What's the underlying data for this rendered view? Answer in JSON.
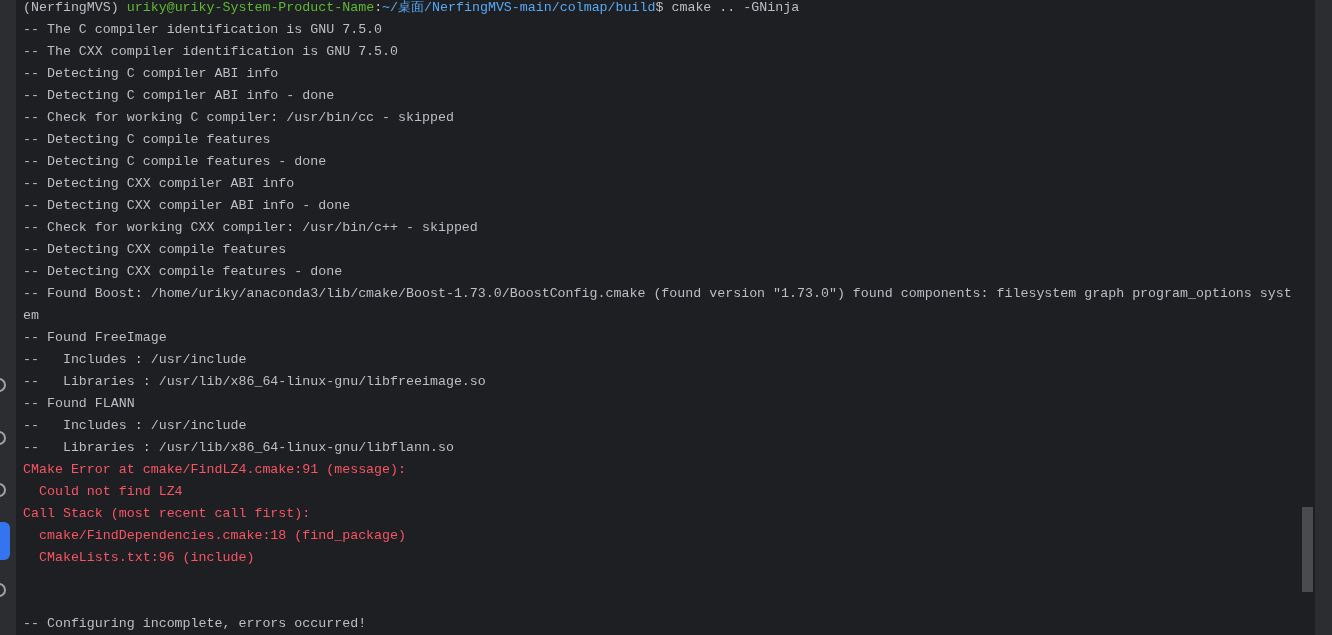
{
  "toolbar": [
    {
      "selected": false
    },
    {
      "selected": false
    },
    {
      "selected": false
    },
    {
      "selected": true
    },
    {
      "selected": false
    }
  ],
  "prompt": {
    "env": "(NerfingMVS)",
    "user_host": "uriky@uriky-System-Product-Name",
    "separator": ":",
    "path": "~/桌面/NerfingMVS-main/colmap/build",
    "command": "$ cmake .. -GNinja"
  },
  "lines": [
    {
      "kind": "info",
      "text": "-- The C compiler identification is GNU 7.5.0"
    },
    {
      "kind": "info",
      "text": "-- The CXX compiler identification is GNU 7.5.0"
    },
    {
      "kind": "info",
      "text": "-- Detecting C compiler ABI info"
    },
    {
      "kind": "info",
      "text": "-- Detecting C compiler ABI info - done"
    },
    {
      "kind": "info",
      "text": "-- Check for working C compiler: /usr/bin/cc - skipped"
    },
    {
      "kind": "info",
      "text": "-- Detecting C compile features"
    },
    {
      "kind": "info",
      "text": "-- Detecting C compile features - done"
    },
    {
      "kind": "info",
      "text": "-- Detecting CXX compiler ABI info"
    },
    {
      "kind": "info",
      "text": "-- Detecting CXX compiler ABI info - done"
    },
    {
      "kind": "info",
      "text": "-- Check for working CXX compiler: /usr/bin/c++ - skipped"
    },
    {
      "kind": "info",
      "text": "-- Detecting CXX compile features"
    },
    {
      "kind": "info",
      "text": "-- Detecting CXX compile features - done"
    },
    {
      "kind": "info",
      "text": "-- Found Boost: /home/uriky/anaconda3/lib/cmake/Boost-1.73.0/BoostConfig.cmake (found version \"1.73.0\") found components: filesystem graph program_options syst"
    },
    {
      "kind": "info",
      "text": "em"
    },
    {
      "kind": "info",
      "text": "-- Found FreeImage"
    },
    {
      "kind": "info",
      "text": "--   Includes : /usr/include"
    },
    {
      "kind": "info",
      "text": "--   Libraries : /usr/lib/x86_64-linux-gnu/libfreeimage.so"
    },
    {
      "kind": "info",
      "text": "-- Found FLANN"
    },
    {
      "kind": "info",
      "text": "--   Includes : /usr/include"
    },
    {
      "kind": "info",
      "text": "--   Libraries : /usr/lib/x86_64-linux-gnu/libflann.so"
    },
    {
      "kind": "error",
      "text": "CMake Error at cmake/FindLZ4.cmake:91 (message):"
    },
    {
      "kind": "error",
      "text": "  Could not find LZ4"
    },
    {
      "kind": "error",
      "text": "Call Stack (most recent call first):"
    },
    {
      "kind": "error",
      "text": "  cmake/FindDependencies.cmake:18 (find_package)"
    },
    {
      "kind": "error",
      "text": "  CMakeLists.txt:96 (include)"
    },
    {
      "kind": "blank"
    },
    {
      "kind": "blank"
    },
    {
      "kind": "info",
      "text": "-- Configuring incomplete, errors occurred!"
    }
  ]
}
